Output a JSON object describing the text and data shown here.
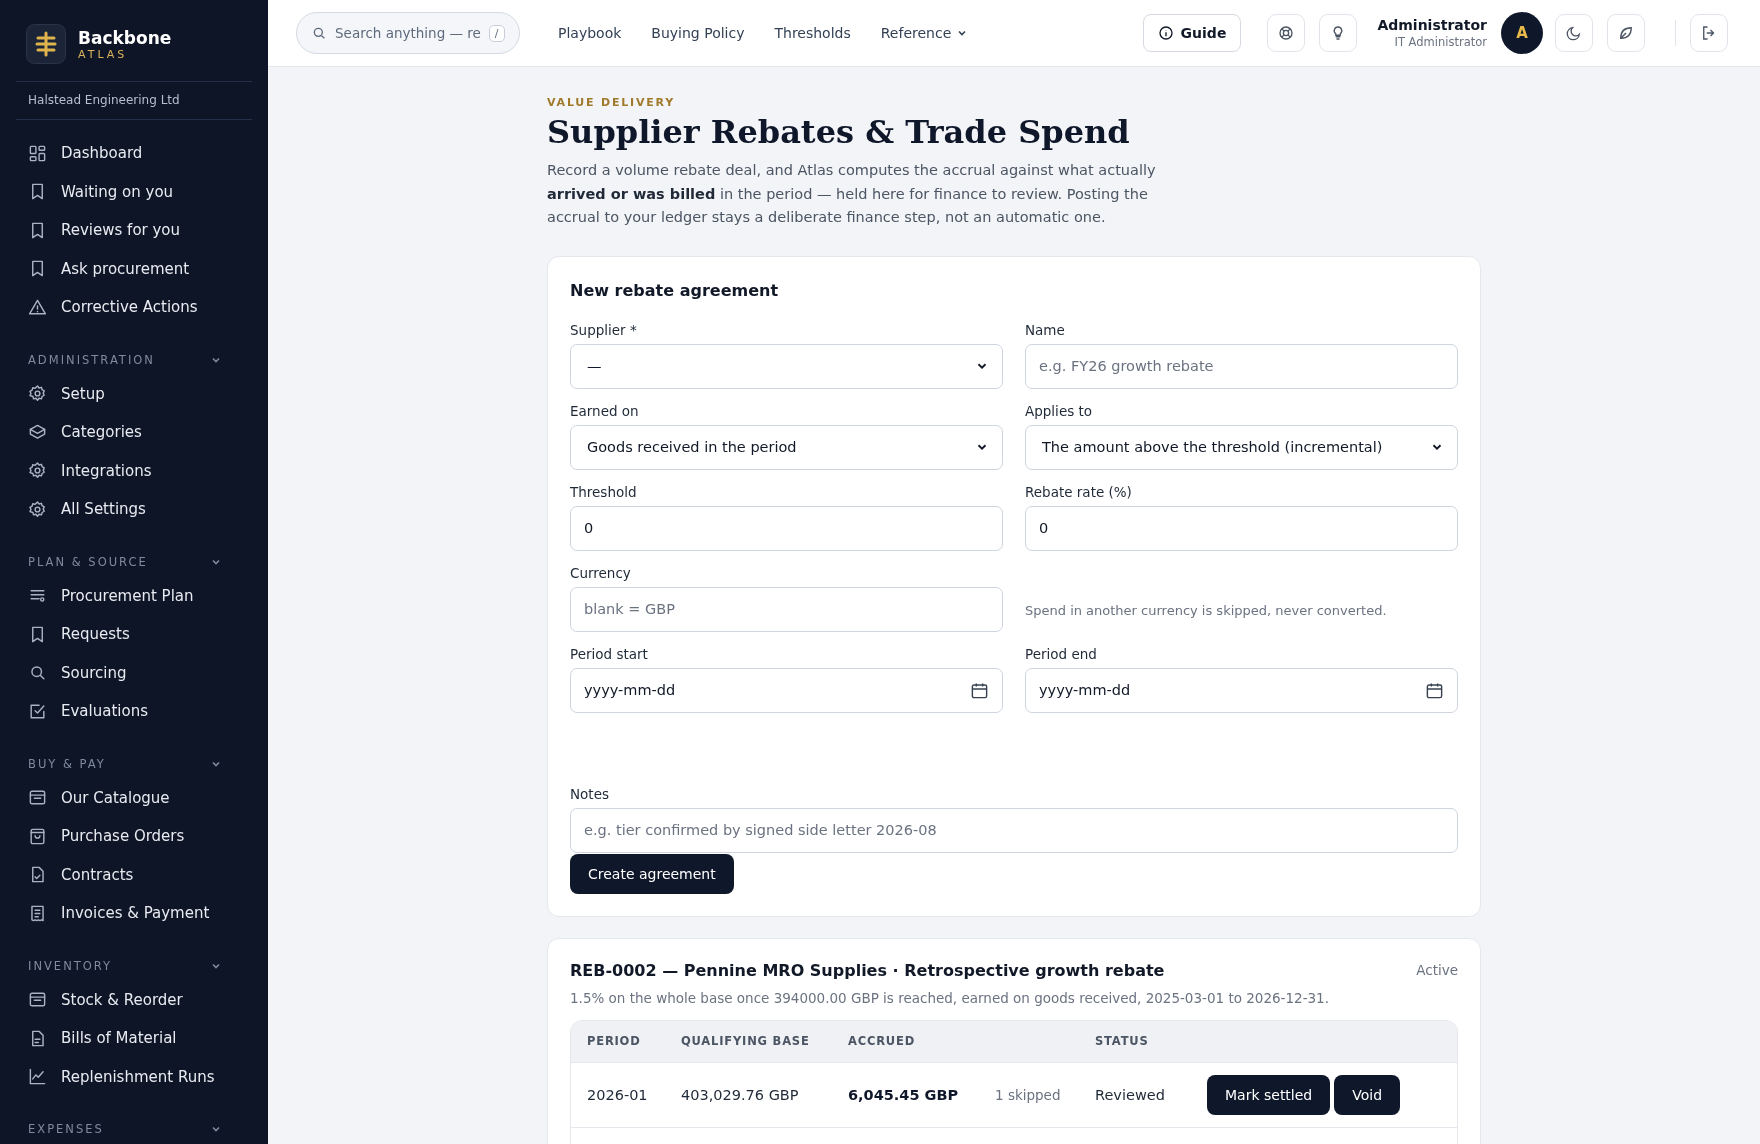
{
  "brand": {
    "name": "Backbone",
    "sub": "ATLAS"
  },
  "org": "Halstead Engineering Ltd",
  "nav": [
    {
      "items": [
        "Dashboard",
        "Waiting on you",
        "Reviews for you",
        "Ask procurement",
        "Corrective Actions"
      ]
    },
    {
      "title": "ADMINISTRATION",
      "items": [
        "Setup",
        "Categories",
        "Integrations",
        "All Settings"
      ]
    },
    {
      "title": "PLAN & SOURCE",
      "items": [
        "Procurement Plan",
        "Requests",
        "Sourcing",
        "Evaluations"
      ]
    },
    {
      "title": "BUY & PAY",
      "items": [
        "Our Catalogue",
        "Purchase Orders",
        "Contracts",
        "Invoices & Payment"
      ]
    },
    {
      "title": "INVENTORY",
      "items": [
        "Stock & Reorder",
        "Bills of Material",
        "Replenishment Runs"
      ]
    },
    {
      "title": "EXPENSES"
    }
  ],
  "topbar": {
    "search": {
      "placeholder": "Search anything — re",
      "key": "/"
    },
    "links": [
      {
        "label": "Playbook",
        "menu": false
      },
      {
        "label": "Buying Policy",
        "menu": false
      },
      {
        "label": "Thresholds",
        "menu": false
      },
      {
        "label": "Reference",
        "menu": true
      }
    ],
    "guide": "Guide",
    "user": {
      "name": "Administrator",
      "role": "IT Administrator",
      "initial": "A"
    }
  },
  "page": {
    "eyebrow": "VALUE DELIVERY",
    "title": "Supplier Rebates & Trade Spend",
    "intro": "Record a volume rebate deal, and Atlas computes the accrual against what actually **arrived or was billed** in the period — held here for finance to review. Posting the accrual to your ledger stays a deliberate finance step, not an automatic one."
  },
  "form": {
    "title": "New rebate agreement",
    "fields": [
      {
        "kind": "select",
        "label": "Supplier *",
        "value": "—"
      },
      {
        "kind": "input",
        "label": "Name",
        "placeholder": "e.g. FY26 growth rebate"
      },
      {
        "kind": "select",
        "label": "Earned on",
        "value": "Goods received in the period"
      },
      {
        "kind": "select",
        "label": "Applies to",
        "value": "The amount above the threshold (incremental)"
      },
      {
        "kind": "input",
        "label": "Threshold",
        "value": "0"
      },
      {
        "kind": "input",
        "label": "Rebate rate (%)",
        "value": "0"
      },
      {
        "kind": "input",
        "label": "Currency",
        "placeholder": "blank = GBP"
      },
      {
        "kind": "hint",
        "text": "Spend in another currency is skipped, never converted."
      },
      {
        "kind": "date",
        "label": "Period start",
        "placeholder": "yyyy-mm-dd"
      },
      {
        "kind": "date",
        "label": "Period end",
        "placeholder": "yyyy-mm-dd"
      }
    ],
    "notes": {
      "label": "Notes",
      "placeholder": "e.g. tier confirmed by signed side letter 2026-08"
    },
    "submit": "Create agreement"
  },
  "agreement": {
    "title": "REB-0002 — Pennine MRO Supplies · Retrospective growth rebate",
    "status": "Active",
    "summary": "1.5% on the whole base once 394000.00 GBP is reached, earned on goods received, 2025-03-01 to 2026-12-31.",
    "columns": [
      "PERIOD",
      "QUALIFYING BASE",
      "ACCRUED",
      "STATUS"
    ],
    "rows": [
      {
        "period": "2026-01",
        "base": "403,029.76 GBP",
        "accrued": "6,045.45 GBP",
        "skipped": "1 skipped",
        "status": "Reviewed",
        "actions": [
          "Mark settled",
          "Void"
        ]
      }
    ]
  }
}
